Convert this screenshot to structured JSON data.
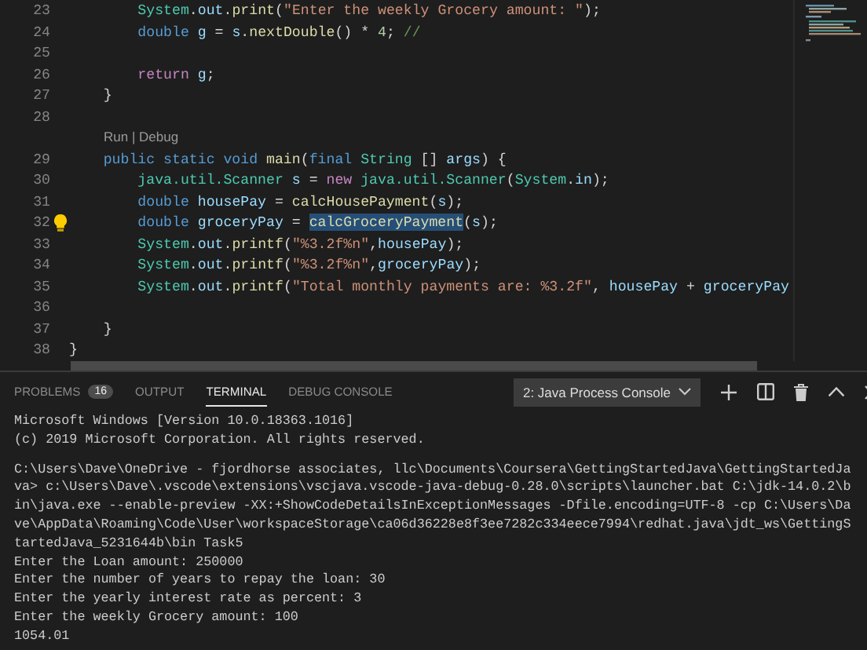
{
  "editor": {
    "lines": [
      {
        "kind": "code",
        "number": "23",
        "lightbulb": false,
        "tokens": [
          {
            "text": "        System",
            "kind": "ty"
          },
          {
            "text": ".",
            "kind": "p"
          },
          {
            "text": "out",
            "kind": "var"
          },
          {
            "text": ".",
            "kind": "p"
          },
          {
            "text": "print",
            "kind": "fn"
          },
          {
            "text": "(",
            "kind": "p"
          },
          {
            "text": "\"Enter the weekly Grocery amount: \"",
            "kind": "str"
          },
          {
            "text": ");",
            "kind": "p"
          }
        ]
      },
      {
        "kind": "code",
        "number": "24",
        "lightbulb": false,
        "tokens": [
          {
            "text": "        double ",
            "kind": "kw"
          },
          {
            "text": "g",
            "kind": "var"
          },
          {
            "text": " = ",
            "kind": "p"
          },
          {
            "text": "s",
            "kind": "var"
          },
          {
            "text": ".",
            "kind": "p"
          },
          {
            "text": "nextDouble",
            "kind": "fn"
          },
          {
            "text": "() * ",
            "kind": "p"
          },
          {
            "text": "4",
            "kind": "num"
          },
          {
            "text": "; ",
            "kind": "p"
          },
          {
            "text": "//",
            "kind": "cm"
          }
        ]
      },
      {
        "kind": "code",
        "number": "25",
        "lightbulb": false
      },
      {
        "kind": "code",
        "number": "26",
        "lightbulb": false,
        "tokens": [
          {
            "text": "        return ",
            "kind": "ctl"
          },
          {
            "text": "g",
            "kind": "var"
          },
          {
            "text": ";",
            "kind": "p"
          }
        ]
      },
      {
        "kind": "code",
        "number": "27",
        "lightbulb": false,
        "tokens": [
          {
            "text": "    }",
            "kind": "p"
          }
        ]
      },
      {
        "kind": "code",
        "number": "28",
        "lightbulb": false
      },
      {
        "kind": "codelens",
        "text": "Run | Debug"
      },
      {
        "kind": "code",
        "number": "29",
        "lightbulb": false,
        "tokens": [
          {
            "text": "    public static void ",
            "kind": "kw"
          },
          {
            "text": "main",
            "kind": "fn"
          },
          {
            "text": "(",
            "kind": "p"
          },
          {
            "text": "final ",
            "kind": "kw"
          },
          {
            "text": "String",
            "kind": "ty"
          },
          {
            "text": " [] ",
            "kind": "p"
          },
          {
            "text": "args",
            "kind": "var"
          },
          {
            "text": ") {",
            "kind": "p"
          }
        ]
      },
      {
        "kind": "code",
        "number": "30",
        "lightbulb": false,
        "tokens": [
          {
            "text": "        java.util.Scanner ",
            "kind": "ty"
          },
          {
            "text": "s",
            "kind": "var"
          },
          {
            "text": " = ",
            "kind": "p"
          },
          {
            "text": "new ",
            "kind": "ctl"
          },
          {
            "text": "java.util.Scanner",
            "kind": "ty"
          },
          {
            "text": "(",
            "kind": "p"
          },
          {
            "text": "System",
            "kind": "ty"
          },
          {
            "text": ".",
            "kind": "p"
          },
          {
            "text": "in",
            "kind": "var"
          },
          {
            "text": ");",
            "kind": "p"
          }
        ]
      },
      {
        "kind": "code",
        "number": "31",
        "lightbulb": false,
        "tokens": [
          {
            "text": "        double ",
            "kind": "kw"
          },
          {
            "text": "housePay",
            "kind": "var"
          },
          {
            "text": " = ",
            "kind": "p"
          },
          {
            "text": "calcHousePayment",
            "kind": "fn"
          },
          {
            "text": "(",
            "kind": "p"
          },
          {
            "text": "s",
            "kind": "var"
          },
          {
            "text": ");",
            "kind": "p"
          }
        ]
      },
      {
        "kind": "code",
        "number": "32",
        "lightbulb": true,
        "tokens": [
          {
            "text": "        double ",
            "kind": "kw"
          },
          {
            "text": "groceryPay",
            "kind": "var"
          },
          {
            "text": " = ",
            "kind": "p"
          },
          {
            "text": "calcGroceryPayment",
            "kind": "hl"
          },
          {
            "text": "(",
            "kind": "p"
          },
          {
            "text": "s",
            "kind": "var"
          },
          {
            "text": ");",
            "kind": "p"
          }
        ]
      },
      {
        "kind": "code",
        "number": "33",
        "lightbulb": false,
        "tokens": [
          {
            "text": "        System",
            "kind": "ty"
          },
          {
            "text": ".",
            "kind": "p"
          },
          {
            "text": "out",
            "kind": "var"
          },
          {
            "text": ".",
            "kind": "p"
          },
          {
            "text": "printf",
            "kind": "fn"
          },
          {
            "text": "(",
            "kind": "p"
          },
          {
            "text": "\"%3.2f%n\"",
            "kind": "str"
          },
          {
            "text": ",",
            "kind": "p"
          },
          {
            "text": "housePay",
            "kind": "var"
          },
          {
            "text": ");",
            "kind": "p"
          }
        ]
      },
      {
        "kind": "code",
        "number": "34",
        "lightbulb": false,
        "tokens": [
          {
            "text": "        System",
            "kind": "ty"
          },
          {
            "text": ".",
            "kind": "p"
          },
          {
            "text": "out",
            "kind": "var"
          },
          {
            "text": ".",
            "kind": "p"
          },
          {
            "text": "printf",
            "kind": "fn"
          },
          {
            "text": "(",
            "kind": "p"
          },
          {
            "text": "\"%3.2f%n\"",
            "kind": "str"
          },
          {
            "text": ",",
            "kind": "p"
          },
          {
            "text": "groceryPay",
            "kind": "var"
          },
          {
            "text": ");",
            "kind": "p"
          }
        ]
      },
      {
        "kind": "code",
        "number": "35",
        "lightbulb": false,
        "tokens": [
          {
            "text": "        System",
            "kind": "ty"
          },
          {
            "text": ".",
            "kind": "p"
          },
          {
            "text": "out",
            "kind": "var"
          },
          {
            "text": ".",
            "kind": "p"
          },
          {
            "text": "printf",
            "kind": "fn"
          },
          {
            "text": "(",
            "kind": "p"
          },
          {
            "text": "\"Total monthly payments are: %3.2f\"",
            "kind": "str"
          },
          {
            "text": ", ",
            "kind": "p"
          },
          {
            "text": "housePay",
            "kind": "var"
          },
          {
            "text": " + ",
            "kind": "p"
          },
          {
            "text": "groceryPay",
            "kind": "var"
          }
        ]
      },
      {
        "kind": "code",
        "number": "36",
        "lightbulb": false
      },
      {
        "kind": "code",
        "number": "37",
        "lightbulb": false,
        "tokens": [
          {
            "text": "    }",
            "kind": "p"
          }
        ]
      },
      {
        "kind": "code",
        "number": "38",
        "lightbulb": false,
        "tokens": [
          {
            "text": "}",
            "kind": "p"
          }
        ]
      }
    ]
  },
  "panel": {
    "tabs": [
      {
        "label": "PROBLEMS",
        "badge": "16",
        "selected": false
      },
      {
        "label": "OUTPUT",
        "selected": false
      },
      {
        "label": "TERMINAL",
        "selected": true
      },
      {
        "label": "DEBUG CONSOLE",
        "selected": false
      }
    ],
    "terminal_selector": "2: Java Process Console"
  },
  "terminal": {
    "blocks": [
      [
        "Microsoft Windows [Version 10.0.18363.1016]",
        "(c) 2019 Microsoft Corporation. All rights reserved."
      ],
      [
        "C:\\Users\\Dave\\OneDrive - fjordhorse associates, llc\\Documents\\Coursera\\GettingStartedJava\\GettingStartedJa",
        "va> c:\\Users\\Dave\\.vscode\\extensions\\vscjava.vscode-java-debug-0.28.0\\scripts\\launcher.bat C:\\jdk-14.0.2\\b",
        "in\\java.exe --enable-preview -XX:+ShowCodeDetailsInExceptionMessages -Dfile.encoding=UTF-8 -cp C:\\Users\\Da",
        "ve\\AppData\\Roaming\\Code\\User\\workspaceStorage\\ca06d36228e8f3ee7282c334eece7994\\redhat.java\\jdt_ws\\GettingS",
        "tartedJava_5231644b\\bin Task5",
        "Enter the Loan amount: 250000",
        "Enter the number of years to repay the loan: 30",
        "Enter the yearly interest rate as percent: 3",
        "Enter the weekly Grocery amount: 100",
        "1054.01"
      ]
    ]
  }
}
